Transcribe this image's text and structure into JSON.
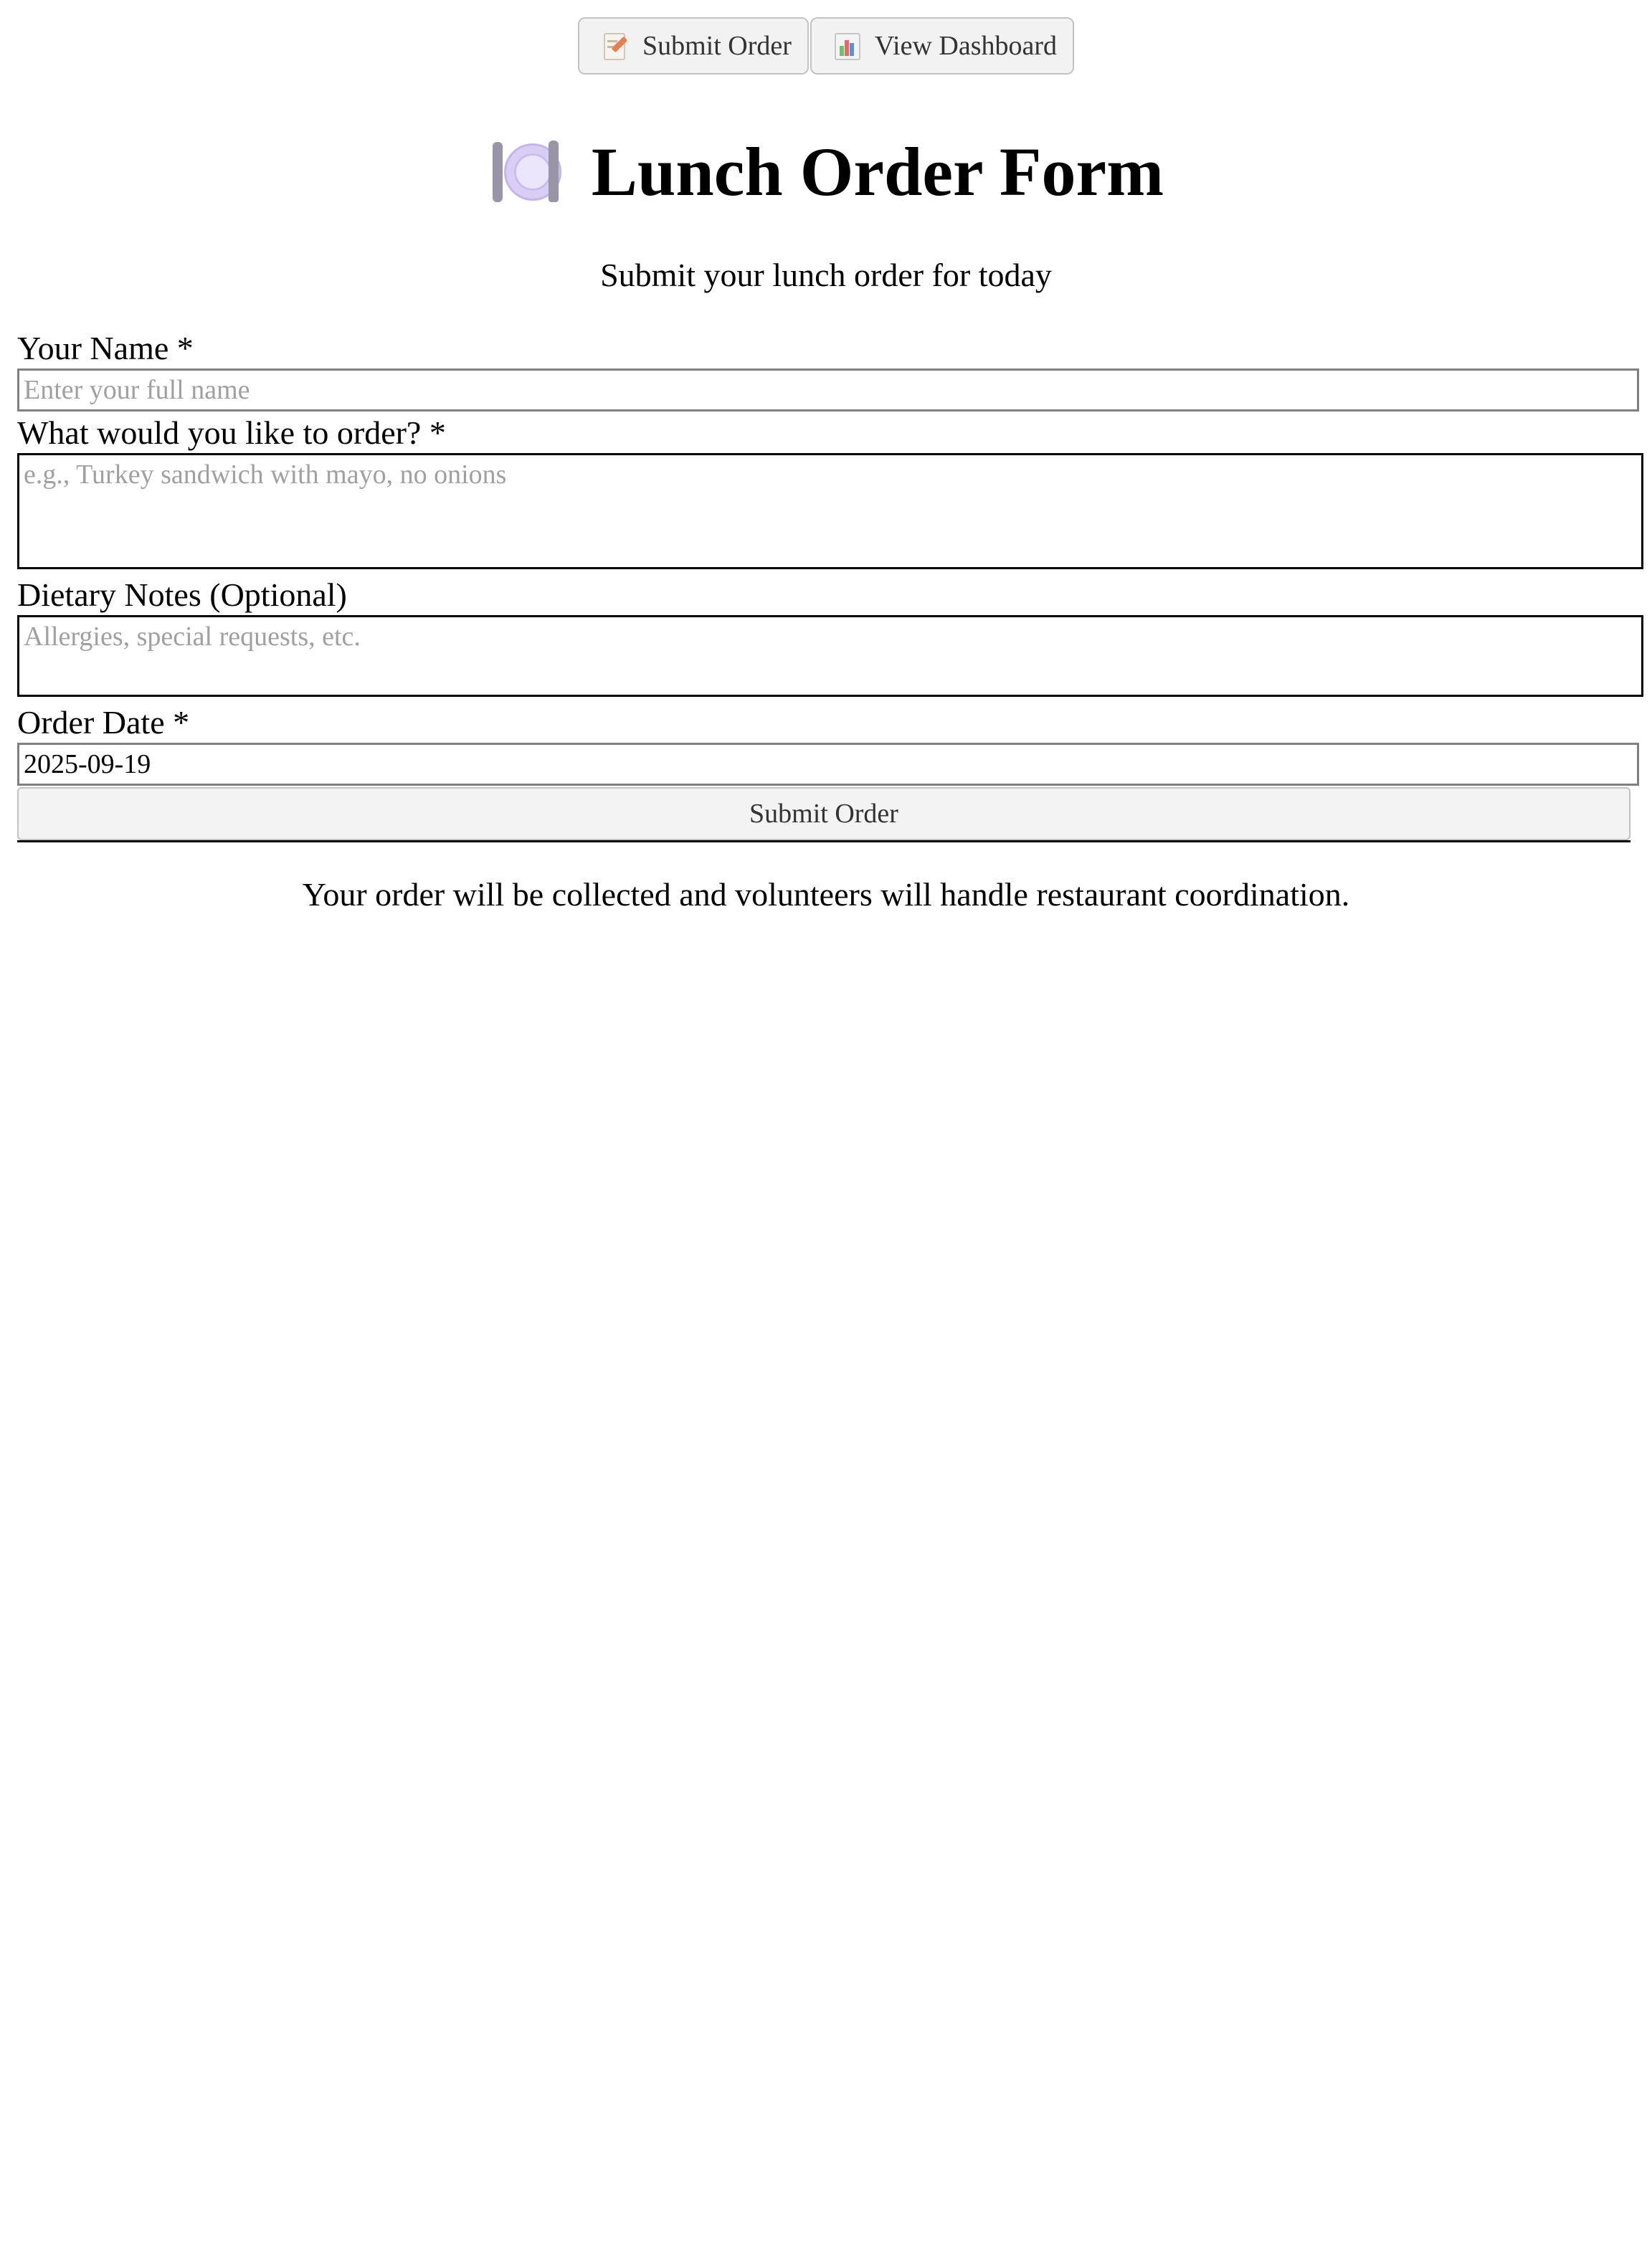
{
  "nav": {
    "submit_label": "Submit Order",
    "submit_icon": "memo-icon",
    "dashboard_label": "View Dashboard",
    "dashboard_icon": "bar-chart-icon"
  },
  "header": {
    "icon": "plate-with-cutlery-icon",
    "title": "Lunch Order Form",
    "subtitle": "Submit your lunch order for today"
  },
  "form": {
    "name": {
      "label": "Your Name *",
      "value": "",
      "placeholder": "Enter your full name"
    },
    "order": {
      "label": "What would you like to order? *",
      "value": "",
      "placeholder": "e.g., Turkey sandwich with mayo, no onions"
    },
    "dietary": {
      "label": "Dietary Notes (Optional)",
      "value": "",
      "placeholder": "Allergies, special requests, etc."
    },
    "date": {
      "label": "Order Date *",
      "value": "2025-09-19"
    },
    "submit_label": "Submit Order"
  },
  "footer": {
    "note": "Your order will be collected and volunteers will handle restaurant coordination."
  },
  "colors": {
    "button_bg": "#f2f2f2",
    "button_border": "#c3c3c3",
    "placeholder": "#a0a0a0",
    "icon_plate": "#d9cdf3"
  }
}
